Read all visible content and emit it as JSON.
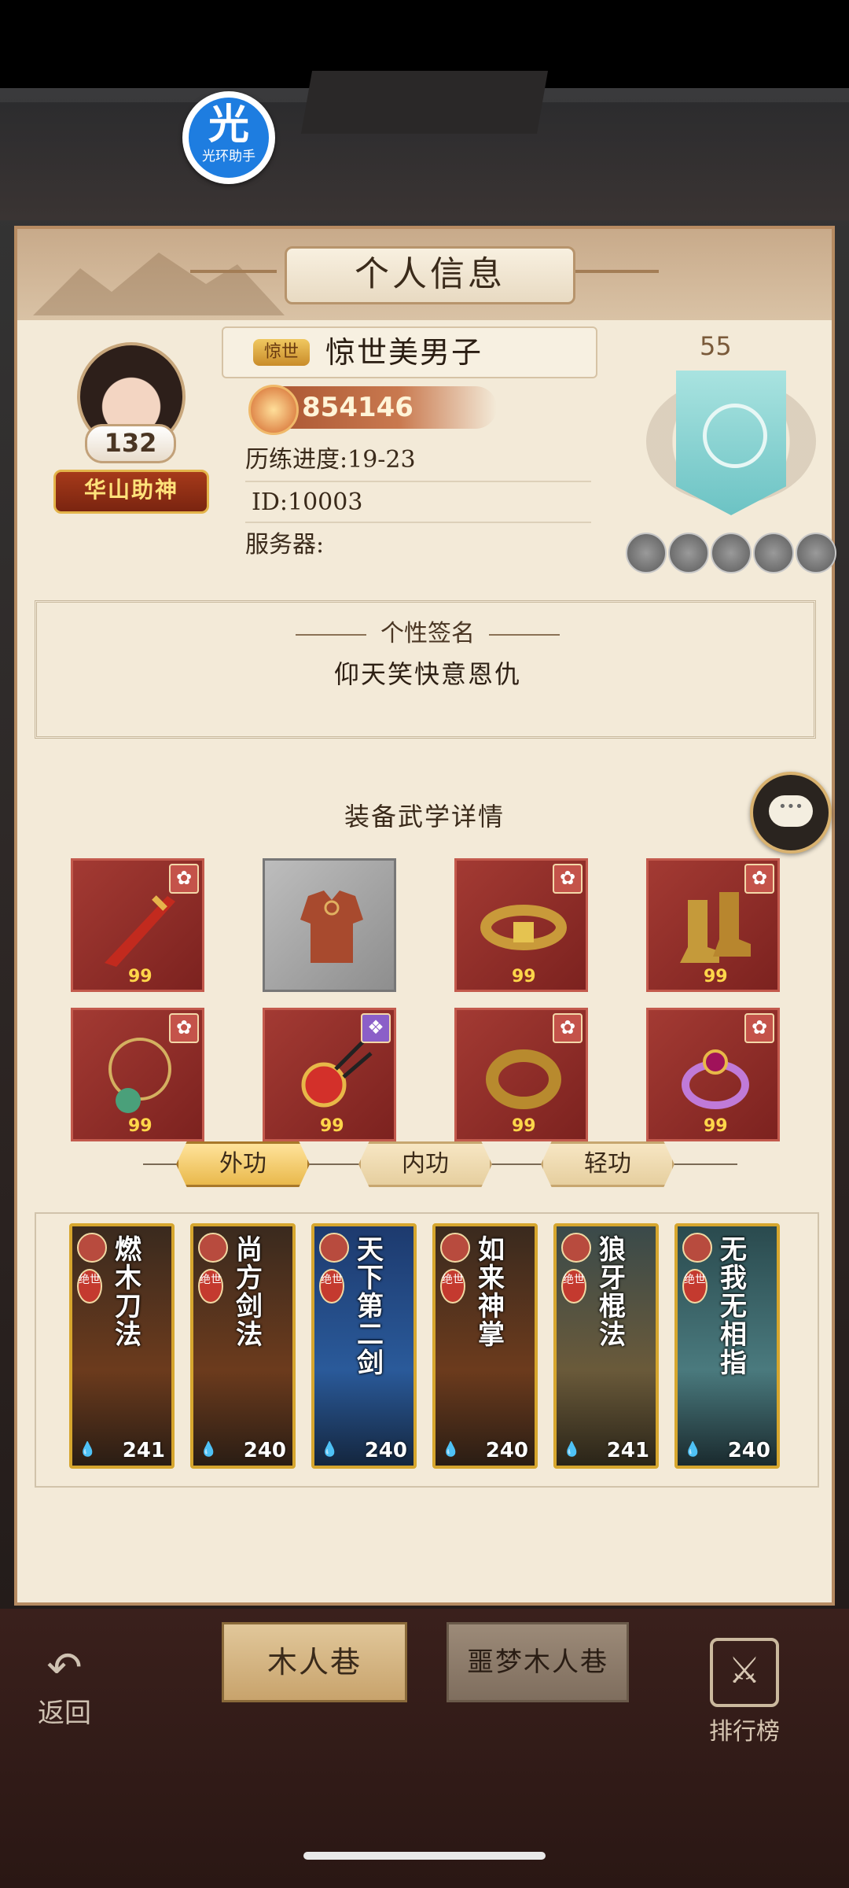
{
  "overlay_badge": {
    "glyph": "光",
    "label": "光环助手"
  },
  "panel": {
    "title": "个人信息"
  },
  "player": {
    "level": "132",
    "rank_banner": "华山助神",
    "name_tag": "惊世",
    "name": "惊世美男子",
    "power": "854146",
    "progress": "历练进度:19-23",
    "id": "ID:10003",
    "server": "服务器:"
  },
  "crest": {
    "number": "55"
  },
  "signature": {
    "title": "个性签名",
    "text": "仰天笑快意恩仇"
  },
  "equipment": {
    "title": "装备武学详情",
    "items": [
      {
        "name": "weapon-icon",
        "level": "99",
        "star": "✿",
        "star_color": "red"
      },
      {
        "name": "armor-icon",
        "level": "",
        "star": "",
        "star_color": ""
      },
      {
        "name": "belt-icon",
        "level": "99",
        "star": "✿",
        "star_color": "red"
      },
      {
        "name": "boots-icon",
        "level": "99",
        "star": "✿",
        "star_color": "red"
      },
      {
        "name": "necklace-icon",
        "level": "99",
        "star": "✿",
        "star_color": "red"
      },
      {
        "name": "hairpin-icon",
        "level": "99",
        "star": "❖",
        "star_color": "purple"
      },
      {
        "name": "bracelet-icon",
        "level": "99",
        "star": "✿",
        "star_color": "red"
      },
      {
        "name": "ring-icon",
        "level": "99",
        "star": "✿",
        "star_color": "red"
      }
    ]
  },
  "tabs": [
    {
      "label": "外功",
      "active": true
    },
    {
      "label": "内功",
      "active": false
    },
    {
      "label": "轻功",
      "active": false
    }
  ],
  "skills": [
    {
      "title": "燃木刀法",
      "tag": "绝世",
      "level": "241"
    },
    {
      "title": "尚方剑法",
      "tag": "绝世",
      "level": "240"
    },
    {
      "title": "天下第二剑",
      "tag": "绝世",
      "level": "240"
    },
    {
      "title": "如来神掌",
      "tag": "绝世",
      "level": "240"
    },
    {
      "title": "狼牙棍法",
      "tag": "绝世",
      "level": "241"
    },
    {
      "title": "无我无相指",
      "tag": "绝世",
      "level": "240"
    }
  ],
  "bottom": {
    "back_label": "返回",
    "btn_1": "木人巷",
    "btn_2": "噩梦木人巷",
    "rank_label": "排行榜"
  },
  "colors": {
    "accent_gold": "#d6a62e",
    "panel_bg": "#f3ead8",
    "slot_red": "#a33a33"
  }
}
